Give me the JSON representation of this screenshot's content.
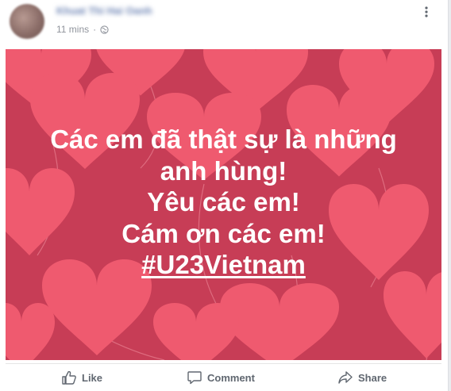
{
  "post": {
    "author": "Khuat Thi Hai Oanh",
    "timestamp": "11 mins",
    "separator": "·",
    "privacy_icon": "globe-icon",
    "menu_icon": "more-vertical-icon"
  },
  "image": {
    "background_color": "#c73d56",
    "heart_color": "#ef5a6f",
    "lines": [
      "Các em đã thật sự là những",
      "anh hùng!",
      "Yêu các em!",
      "Cám ơn các em!"
    ],
    "hashtag": "#U23Vietnam"
  },
  "actions": {
    "like": "Like",
    "comment": "Comment",
    "share": "Share"
  }
}
